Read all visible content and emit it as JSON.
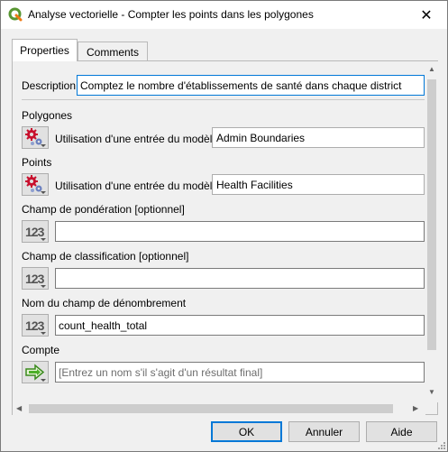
{
  "window": {
    "title": "Analyse vectorielle - Compter les points dans les polygones",
    "close_glyph": "✕",
    "app_icon": "qgis-logo-icon"
  },
  "tabs": [
    {
      "label": "Properties",
      "active": true
    },
    {
      "label": "Comments",
      "active": false
    }
  ],
  "form": {
    "description_label": "Description",
    "description_value": "Comptez le nombre d'établissements de santé dans chaque district",
    "polygones": {
      "label": "Polygones",
      "mode_label": "Utilisation d'une entrée du modèle",
      "value": "Admin Boundaries",
      "icon": "model-input-gears-icon"
    },
    "points": {
      "label": "Points",
      "mode_label": "Utilisation d'une entrée du modèle",
      "value": "Health Facilities",
      "icon": "model-input-gears-icon"
    },
    "weight": {
      "label": "Champ de pondération [optionnel]",
      "icon_text": "123",
      "value": ""
    },
    "class": {
      "label": "Champ de classification [optionnel]",
      "icon_text": "123",
      "value": ""
    },
    "count_field": {
      "label": "Nom du champ de dénombrement",
      "icon_text": "123",
      "value": "count_health_total"
    },
    "output": {
      "label": "Compte",
      "placeholder": "[Entrez un nom s'il s'agit d'un résultat final]",
      "icon": "output-arrow-icon"
    }
  },
  "buttons": {
    "ok": "OK",
    "cancel": "Annuler",
    "help": "Aide"
  },
  "colors": {
    "accent": "#0078d7",
    "qgis_green": "#589632",
    "gear_red": "#c8102e"
  }
}
